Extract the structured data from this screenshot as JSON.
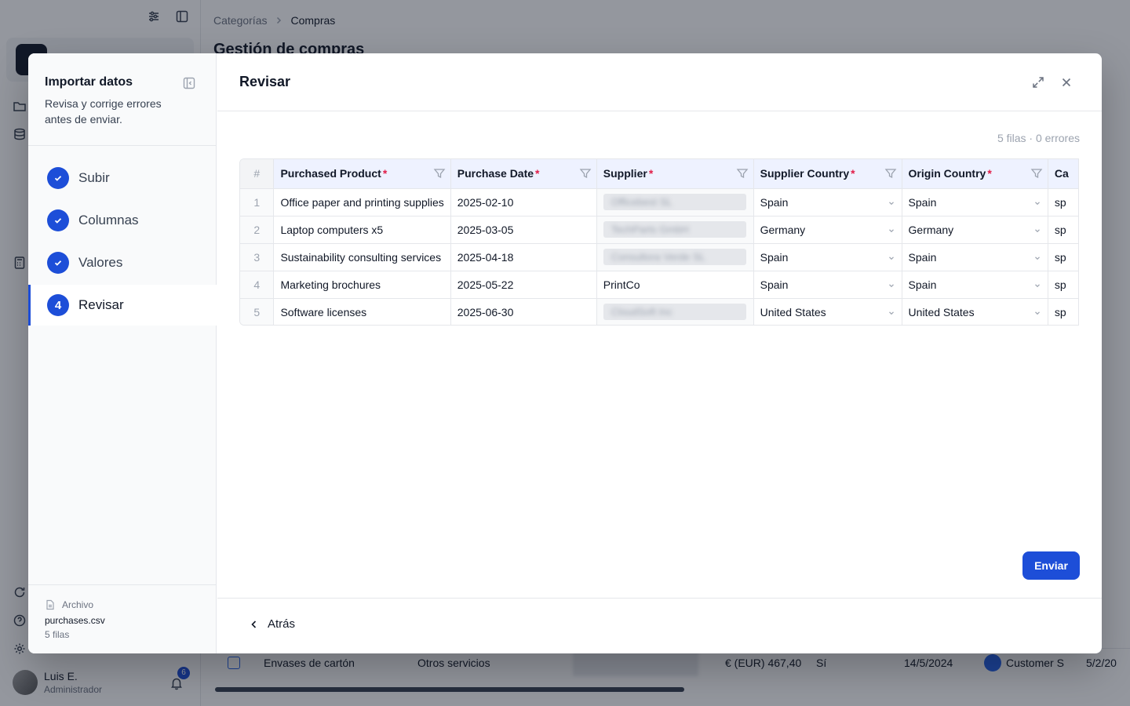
{
  "app": {
    "breadcrumb": [
      "Categorías",
      "Compras"
    ],
    "page_title": "Gestión de compras",
    "user": {
      "name": "Luis E.",
      "role": "Administrador",
      "notifications": "6"
    },
    "bg_row": {
      "product": "Envases de cartón",
      "category": "Otros servicios",
      "amount": "€ (EUR) 467,40",
      "flag": "Sí",
      "date": "14/5/2024",
      "customer": "Customer S",
      "date2": "5/2/20"
    }
  },
  "wizard": {
    "title": "Importar datos",
    "subtitle": "Revisa y corrige errores antes de enviar.",
    "steps": [
      {
        "label": "Subir",
        "state": "done"
      },
      {
        "label": "Columnas",
        "state": "done"
      },
      {
        "label": "Valores",
        "state": "done"
      },
      {
        "label": "Revisar",
        "state": "active",
        "number": "4"
      }
    ],
    "file": {
      "label": "Archivo",
      "name": "purchases.csv",
      "rows": "5 filas"
    }
  },
  "review": {
    "title": "Revisar",
    "summary": "5 filas · 0 errores",
    "columns": [
      {
        "label": "#"
      },
      {
        "label": "Purchased Product",
        "required": "*"
      },
      {
        "label": "Purchase Date",
        "required": "*"
      },
      {
        "label": "Supplier",
        "required": "*"
      },
      {
        "label": "Supplier Country",
        "required": "*"
      },
      {
        "label": "Origin Country",
        "required": "*"
      },
      {
        "label": "Ca"
      }
    ],
    "rows": [
      {
        "n": "1",
        "product": "Office paper and printing supplies",
        "date": "2025-02-10",
        "supplier": "Officebest SL",
        "supplier_blurred": true,
        "supplier_country": "Spain",
        "origin_country": "Spain",
        "extra": "sp"
      },
      {
        "n": "2",
        "product": "Laptop computers x5",
        "date": "2025-03-05",
        "supplier": "TechParts GmbH",
        "supplier_blurred": true,
        "supplier_country": "Germany",
        "origin_country": "Germany",
        "extra": "sp"
      },
      {
        "n": "3",
        "product": "Sustainability consulting services",
        "date": "2025-04-18",
        "supplier": "Consultora Verde SL",
        "supplier_blurred": true,
        "supplier_country": "Spain",
        "origin_country": "Spain",
        "extra": "sp"
      },
      {
        "n": "4",
        "product": "Marketing brochures",
        "date": "2025-05-22",
        "supplier": "PrintCo",
        "supplier_blurred": false,
        "supplier_country": "Spain",
        "origin_country": "Spain",
        "extra": "sp"
      },
      {
        "n": "5",
        "product": "Software licenses",
        "date": "2025-06-30",
        "supplier": "CloudSoft Inc",
        "supplier_blurred": true,
        "supplier_country": "United States",
        "origin_country": "United States",
        "extra": "sp"
      }
    ],
    "send_label": "Enviar",
    "back_label": "Atrás"
  },
  "colors": {
    "accent": "#1d4ed8",
    "required": "#e11d48",
    "header_bg": "#eef2ff"
  }
}
